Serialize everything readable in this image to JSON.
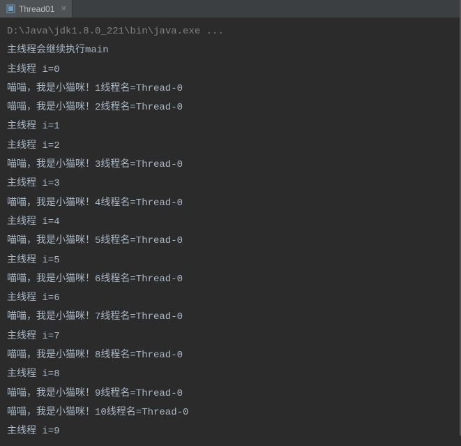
{
  "tab": {
    "label": "Thread01",
    "icon_name": "run-icon"
  },
  "console": {
    "command": "D:\\Java\\jdk1.8.0_221\\bin\\java.exe ...",
    "lines": [
      "主线程会继续执行main",
      "主线程 i=0",
      "喵喵，我是小猫咪！1线程名=Thread-0",
      "喵喵，我是小猫咪！2线程名=Thread-0",
      "主线程 i=1",
      "主线程 i=2",
      "喵喵，我是小猫咪！3线程名=Thread-0",
      "主线程 i=3",
      "喵喵，我是小猫咪！4线程名=Thread-0",
      "主线程 i=4",
      "喵喵，我是小猫咪！5线程名=Thread-0",
      "主线程 i=5",
      "喵喵，我是小猫咪！6线程名=Thread-0",
      "主线程 i=6",
      "喵喵，我是小猫咪！7线程名=Thread-0",
      "主线程 i=7",
      "喵喵，我是小猫咪！8线程名=Thread-0",
      "主线程 i=8",
      "喵喵，我是小猫咪！9线程名=Thread-0",
      "喵喵，我是小猫咪！10线程名=Thread-0",
      "主线程 i=9"
    ]
  }
}
